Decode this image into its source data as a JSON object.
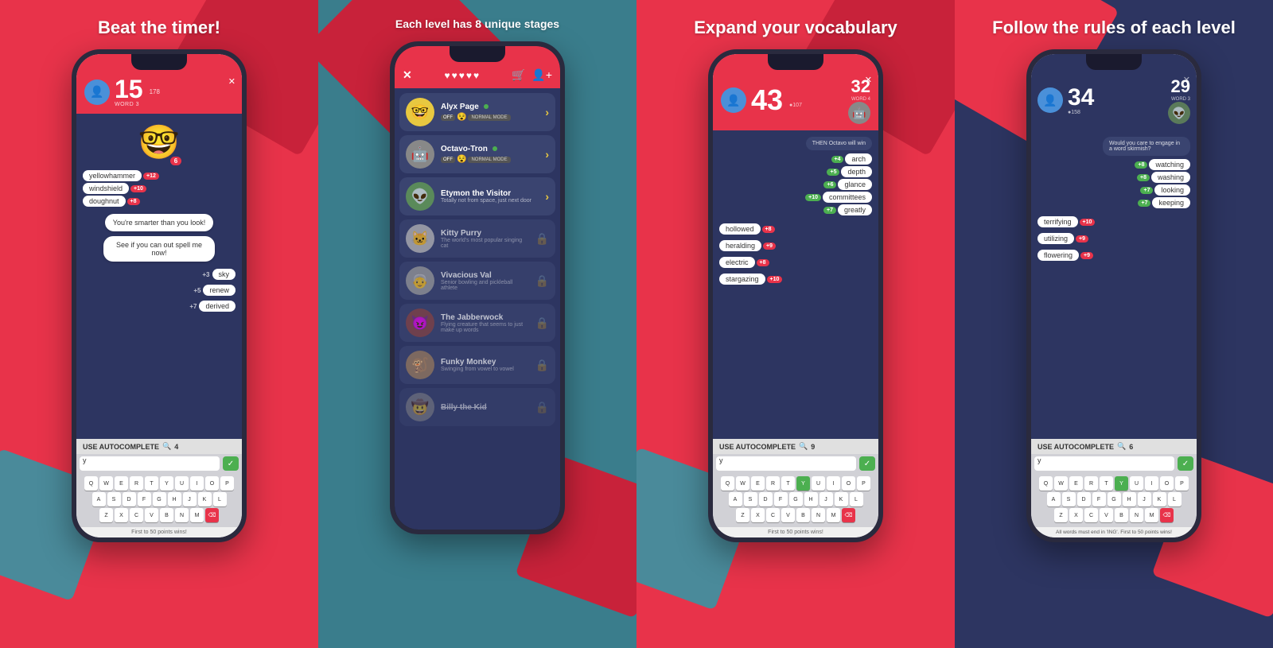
{
  "panels": [
    {
      "id": "panel-1",
      "title": "Beat the timer!",
      "subtitle": "First to 50 points wins!",
      "header": {
        "score": "15",
        "score_label": "WORD 3",
        "player_points": "178"
      },
      "emoji": "🤓",
      "emoji_badge": "6",
      "chats": [
        "You're smarter than you look!",
        "See if you can out spell me now!"
      ],
      "words_left": [
        {
          "label": "yellowhammer",
          "score": "+12"
        },
        {
          "label": "windshield",
          "score": "+10"
        },
        {
          "label": "doughnut",
          "score": "+8"
        }
      ],
      "words_right": [
        {
          "label": "sky",
          "score": "+3"
        },
        {
          "label": "renew",
          "score": "+5"
        },
        {
          "label": "derived",
          "score": "+7"
        }
      ],
      "autocomplete": {
        "label": "USE AUTOCOMPLETE",
        "count": "4"
      },
      "keyboard_input": "y",
      "keyboard_rows": [
        [
          "Q",
          "W",
          "E",
          "R",
          "T",
          "Y",
          "U",
          "I",
          "O",
          "P"
        ],
        [
          "A",
          "S",
          "D",
          "F",
          "G",
          "H",
          "J",
          "K",
          "L"
        ],
        [
          "Z",
          "X",
          "C",
          "V",
          "B",
          "N",
          "M"
        ]
      ]
    },
    {
      "id": "panel-2",
      "title": "Each level has 8 unique stages",
      "players": [
        {
          "name": "Alyx Page",
          "emoji": "🤓",
          "desc": "",
          "mode": "NORMAL MODE",
          "unlocked": true
        },
        {
          "name": "Octavo-Tron",
          "emoji": "🤖",
          "desc": "",
          "mode": "NORMAL MODE",
          "unlocked": true
        },
        {
          "name": "Etymon the Visitor",
          "emoji": "👽",
          "desc": "Totally not from space, just next door",
          "mode": "",
          "unlocked": true
        },
        {
          "name": "Kitty Purry",
          "emoji": "🐱",
          "desc": "The world's most popular singing cat",
          "mode": "",
          "unlocked": false
        },
        {
          "name": "Vivacious Val",
          "emoji": "👵",
          "desc": "Senior bowling and pickleball athlete",
          "mode": "",
          "unlocked": false
        },
        {
          "name": "The Jabberwock",
          "emoji": "😈",
          "desc": "Flying creature that seems to just make up words",
          "mode": "",
          "unlocked": false
        },
        {
          "name": "Funky Monkey",
          "emoji": "🐒",
          "desc": "Swinging from vowel to vowel",
          "mode": "",
          "unlocked": false
        },
        {
          "name": "Billy the Kid",
          "emoji": "🤠",
          "desc": "",
          "mode": "",
          "unlocked": false
        }
      ],
      "hearts": 5
    },
    {
      "id": "panel-3",
      "title": "Expand your vocabulary",
      "header": {
        "player_score": "43",
        "opp_score": "32",
        "word_label": "WORD 4",
        "player_points": "107"
      },
      "opp_chat": "THEN Octavo will win",
      "opp_words": [
        {
          "label": "arch",
          "score": "+4"
        },
        {
          "label": "depth",
          "score": "+5"
        },
        {
          "label": "glance",
          "score": "+6"
        },
        {
          "label": "committees",
          "score": "+10"
        },
        {
          "label": "greatly",
          "score": "+7"
        }
      ],
      "player_words": [
        {
          "label": "hollowed",
          "score": "+8"
        },
        {
          "label": "heralding",
          "score": "+9"
        },
        {
          "label": "electric",
          "score": "+8"
        },
        {
          "label": "stargazing",
          "score": "+10"
        }
      ],
      "autocomplete": {
        "label": "USE AUTOCOMPLETE",
        "count": "9"
      },
      "keyboard_rows": [
        [
          "Q",
          "W",
          "E",
          "R",
          "T",
          "Y",
          "U",
          "I",
          "O",
          "P"
        ],
        [
          "A",
          "S",
          "D",
          "F",
          "G",
          "H",
          "J",
          "K",
          "L"
        ],
        [
          "Z",
          "X",
          "C",
          "V",
          "B",
          "N",
          "M"
        ]
      ]
    },
    {
      "id": "panel-4",
      "title": "Follow the rules of each level",
      "header": {
        "player_score": "34",
        "opp_score": "29",
        "word_label": "WORD 3",
        "player_points": "158"
      },
      "opp_chat": "Would you care to engage in a word skirmish?",
      "opp_words": [
        {
          "label": "watching",
          "score": "+8"
        },
        {
          "label": "washing",
          "score": "+8"
        },
        {
          "label": "looking",
          "score": "+7"
        },
        {
          "label": "keeping",
          "score": "+7"
        }
      ],
      "player_words": [
        {
          "label": "terrifying",
          "score": "+10"
        },
        {
          "label": "utilizing",
          "score": "+9"
        },
        {
          "label": "flowering",
          "score": "+9"
        }
      ],
      "autocomplete": {
        "label": "USE AUTOCOMPLETE",
        "count": "6"
      },
      "rule_text": "All words must end in 'ING'. First to 50 points wins!",
      "keyboard_rows": [
        [
          "Q",
          "W",
          "E",
          "R",
          "T",
          "Y",
          "U",
          "I",
          "O",
          "P"
        ],
        [
          "A",
          "S",
          "D",
          "F",
          "G",
          "H",
          "J",
          "K",
          "L"
        ],
        [
          "Z",
          "X",
          "C",
          "V",
          "B",
          "N",
          "M"
        ]
      ]
    }
  ]
}
